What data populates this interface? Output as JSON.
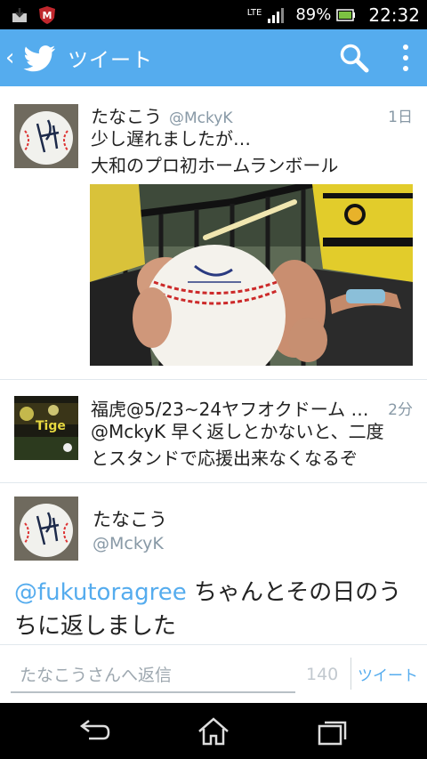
{
  "status_bar": {
    "network": "LTE",
    "battery": "89%",
    "time": "22:32"
  },
  "app_bar": {
    "title": "ツイート",
    "accent": "#55acee"
  },
  "tweets": [
    {
      "name": "たなこう",
      "handle": "@MckyK",
      "time": "1日",
      "lines": [
        "少し遅れましたが…",
        "大和のプロ初ホームランボール"
      ]
    },
    {
      "name": "福虎@5/23~24ヤフオクドーム …",
      "handle": "",
      "time": "2分",
      "lines": [
        "@MckyK 早く返しとかないと、二度",
        "とスタンドで応援出来なくなるぞ"
      ]
    }
  ],
  "detail": {
    "name": "たなこう",
    "handle": "@MckyK",
    "mention": "@fukutoragree",
    "text_line1": " ちゃんとその日のう",
    "text_line2": "ちに返しました"
  },
  "reply": {
    "placeholder": "たなこうさんへ返信",
    "count": "140",
    "button": "ツイート"
  }
}
